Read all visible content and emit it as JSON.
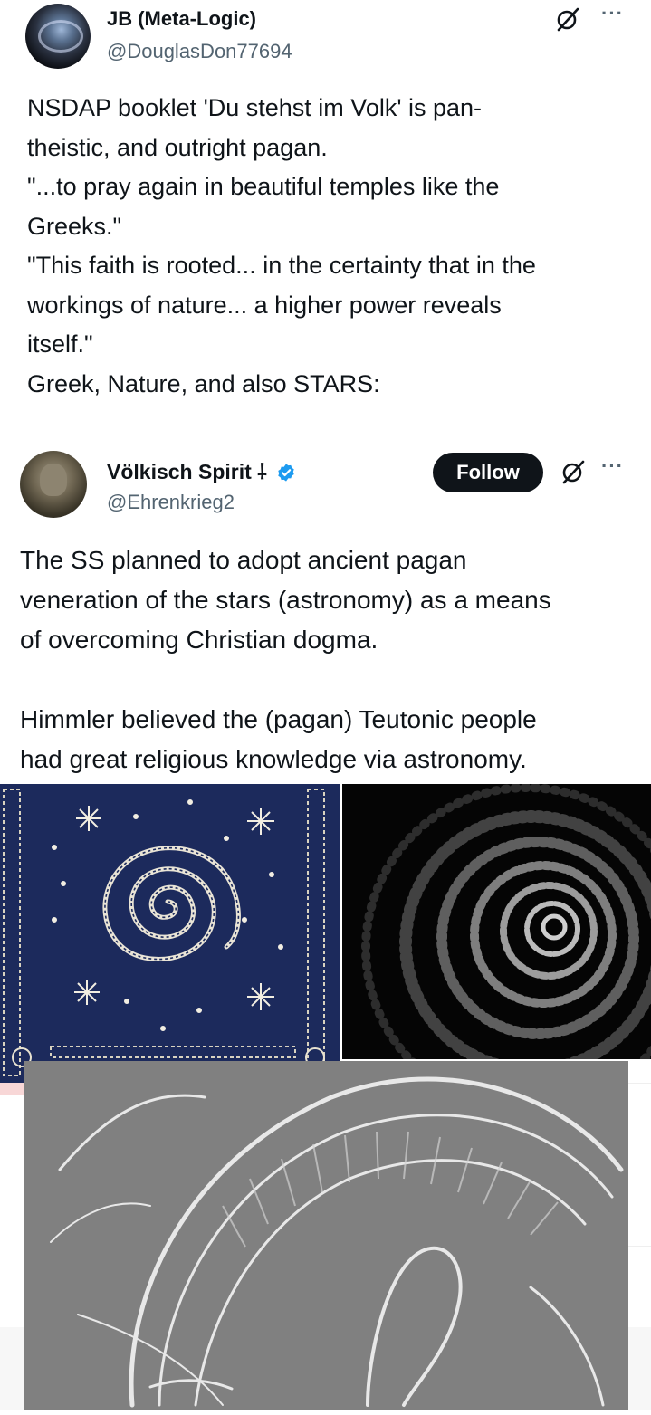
{
  "outer_tweet": {
    "display_name": "JB (Meta-Logic)",
    "handle": "@DouglasDon77694",
    "text_lines": [
      "NSDAP booklet 'Du stehst im Volk' is pan-",
      "theistic, and outright pagan.",
      "\"...to pray again in beautiful temples like the",
      "Greeks.\"",
      "\"This faith is rooted... in the certainty that in the",
      "workings of nature... a higher power reveals",
      "itself.\"",
      "Greek, Nature, and also STARS:"
    ],
    "icons": {
      "grok": "grok-icon",
      "more": "more-options-icon"
    }
  },
  "quoted_tweet": {
    "display_name": "Völkisch Spirit ⸸",
    "handle": "@Ehrenkrieg2",
    "follow_label": "Follow",
    "paragraph_1": [
      "The SS planned to adopt ancient pagan",
      "veneration of the stars (astronomy) as a means",
      "of overcoming Christian dogma."
    ],
    "paragraph_2": [
      "Himmler believed the (pagan) Teutonic people",
      "had great religious knowledge via astronomy."
    ],
    "colors": {
      "verified_badge": "#1d9bf0",
      "follow_button": "#0f1419"
    }
  },
  "images": {
    "star_panel": "spiral-stars-panel-image",
    "dark_spiral": "dark-spiral-galaxy-image",
    "engraving": "ram-horn-engraving-image"
  },
  "more_glyph": "···"
}
